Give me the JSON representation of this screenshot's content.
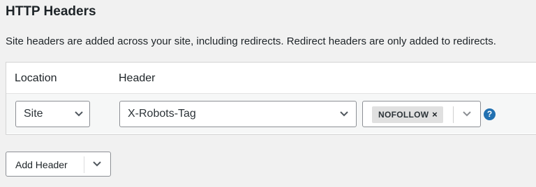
{
  "section": {
    "title": "HTTP Headers",
    "description": "Site headers are added across your site, including redirects. Redirect headers are only added to redirects."
  },
  "table": {
    "columns": [
      "Location",
      "Header"
    ],
    "rows": [
      {
        "location": "Site",
        "header": "X-Robots-Tag",
        "values": [
          "NOFOLLOW"
        ]
      }
    ]
  },
  "icons": {
    "remove_tag": "close-icon",
    "dropdown": "chevron-down-icon",
    "help": "question-icon"
  },
  "help_glyph": "?",
  "remove_glyph": "×",
  "add_button": {
    "label": "Add Header"
  },
  "colors": {
    "accent": "#2271b1",
    "background": "#f1f1f1",
    "tag": "#e0e0e0"
  }
}
